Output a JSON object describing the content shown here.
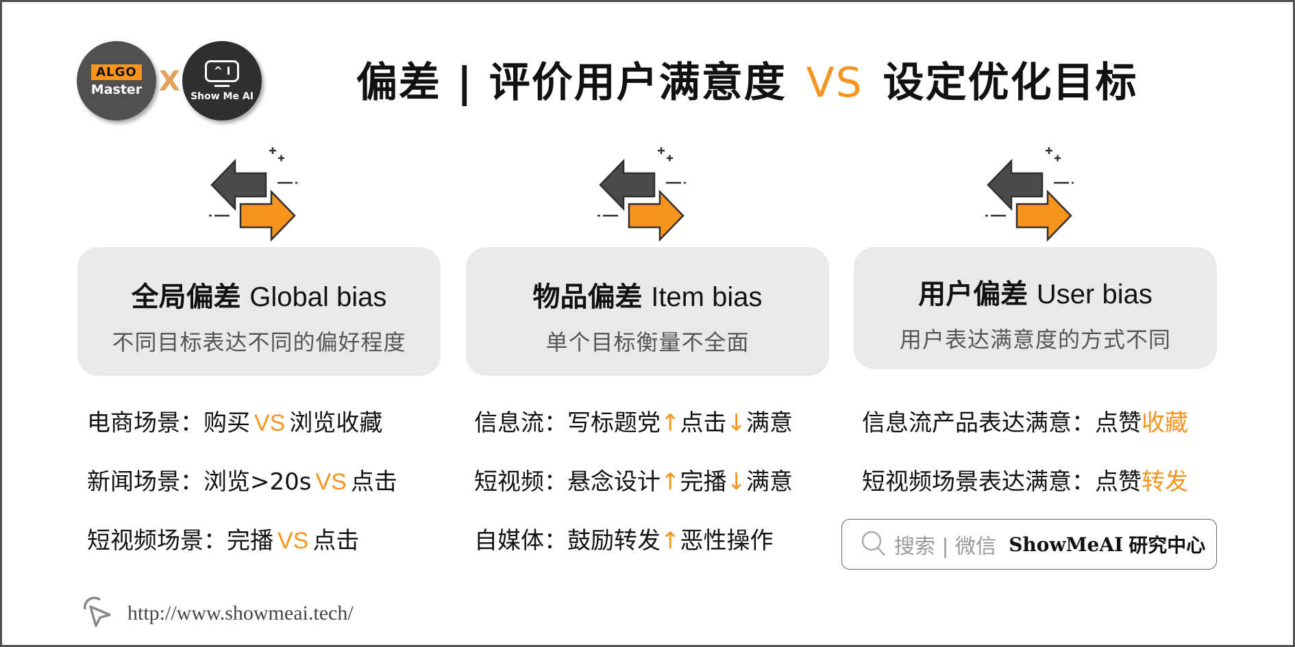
{
  "header": {
    "logo_left": {
      "tag": "ALGO",
      "name": "Master"
    },
    "logo_joiner": "X",
    "logo_right": {
      "screen": "^ I",
      "name": "Show Me AI"
    },
    "title_left": "偏差 | 评价用户满意度",
    "title_vs": "VS",
    "title_right": "设定优化目标"
  },
  "colors": {
    "accent": "#f7941d",
    "dark": "#505050",
    "card_bg": "#e9e9ea"
  },
  "columns": [
    {
      "icon": "swap-arrows-icon",
      "title_zh": "全局偏差",
      "title_en": "Global bias",
      "subtitle": "不同目标表达不同的偏好程度",
      "lines": [
        {
          "pre": "电商场景：购买",
          "vs": "VS",
          "post": "浏览收藏"
        },
        {
          "pre": "新闻场景：浏览>20s",
          "vs": "VS",
          "post": "点击"
        },
        {
          "pre": "短视频场景：完播",
          "vs": "VS",
          "post": "点击"
        }
      ]
    },
    {
      "icon": "swap-arrows-icon",
      "title_zh": "物品偏差",
      "title_en": "Item bias",
      "subtitle": "单个目标衡量不全面",
      "lines": [
        {
          "a": "信息流：写标题党",
          "up": "↑",
          "b": "点击",
          "down": "↓",
          "c": "满意"
        },
        {
          "a": "短视频：悬念设计",
          "up": "↑",
          "b": "完播",
          "down": "↓",
          "c": "满意"
        },
        {
          "a": "自媒体：鼓励转发",
          "up": "↑",
          "b": "恶性操作",
          "down": "",
          "c": ""
        }
      ]
    },
    {
      "icon": "swap-arrows-icon",
      "title_zh": "用户偏差",
      "title_en": "User bias",
      "subtitle": "用户表达满意度的方式不同",
      "lines": [
        {
          "pre": "信息流产品表达满意：点赞",
          "hl": "收藏"
        },
        {
          "pre": "短视频场景表达满意：点赞",
          "hl": "转发"
        }
      ]
    }
  ],
  "search_box": {
    "hint": "搜索 | 微信",
    "brand": "ShowMeAI",
    "brand_zh": "研究中心"
  },
  "footer": {
    "url": "http://www.showmeai.tech/"
  }
}
